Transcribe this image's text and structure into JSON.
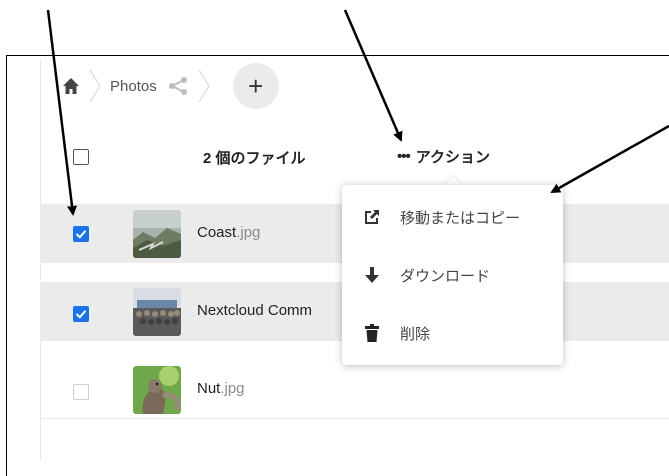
{
  "breadcrumb": {
    "home_icon": "home-icon",
    "folder": "Photos",
    "share_icon": "share-icon",
    "add_label": "+"
  },
  "header": {
    "file_count": "2 個のファイル",
    "actions_dots": "•••",
    "actions_label": "アクション"
  },
  "files": [
    {
      "name": "Coast",
      "ext": ".jpg",
      "checked": true
    },
    {
      "name": "Nextcloud Comm",
      "ext": "",
      "checked": true
    },
    {
      "name": "Nut",
      "ext": ".jpg",
      "checked": false
    }
  ],
  "menu": {
    "items": [
      {
        "label": "移動またはコピー",
        "icon": "external-link-icon"
      },
      {
        "label": "ダウンロード",
        "icon": "download-icon"
      },
      {
        "label": "削除",
        "icon": "trash-icon"
      }
    ]
  },
  "colors": {
    "accent": "#1a73e8",
    "selected_row": "#ebebeb",
    "add_button_bg": "#ebebeb"
  }
}
